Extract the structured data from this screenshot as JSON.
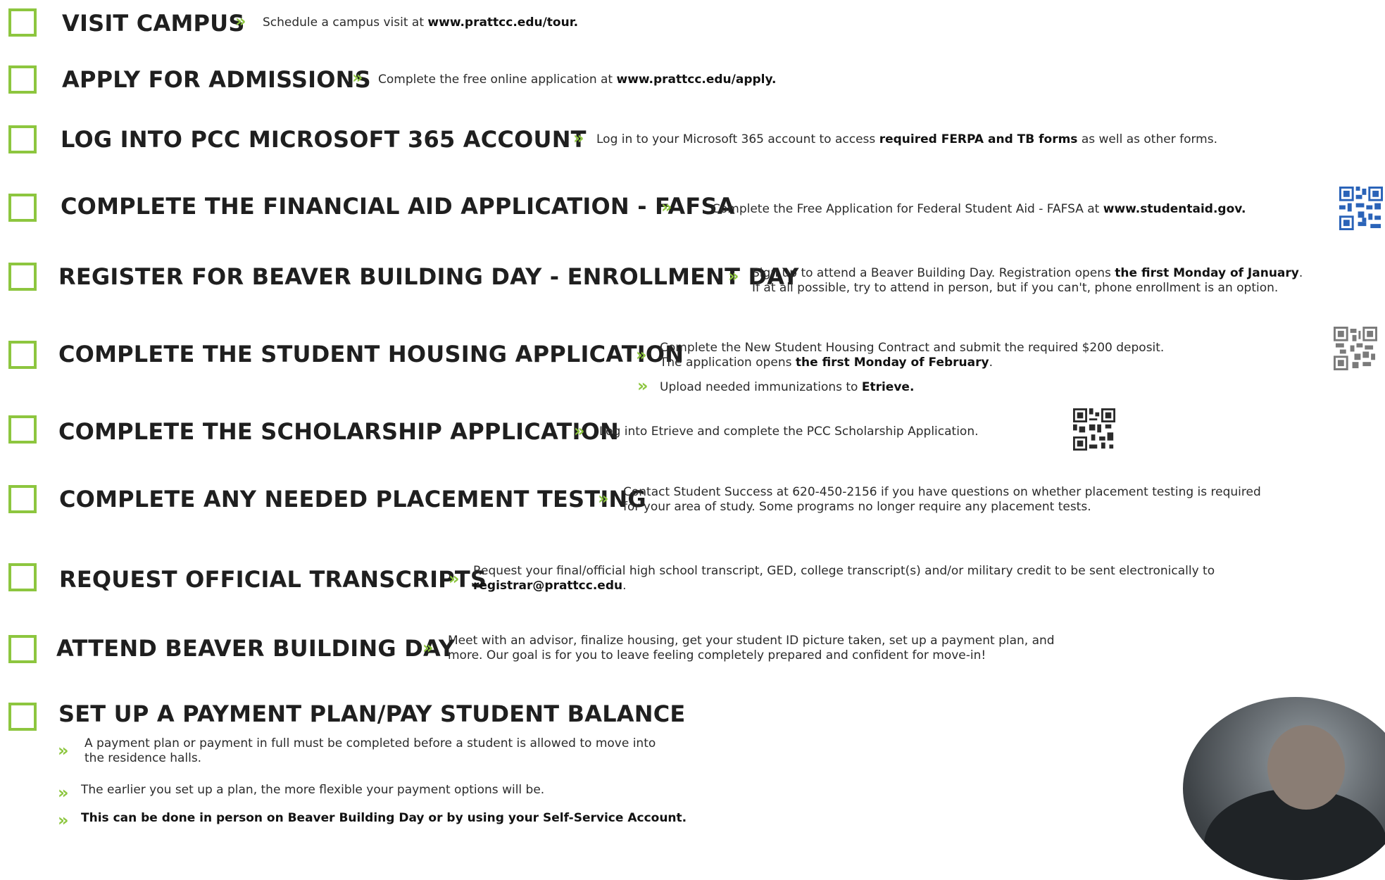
{
  "colors": {
    "accent": "#8dc63f",
    "text": "#1f1f1f"
  },
  "steps": {
    "visit": {
      "title": "VISIT CAMPUS",
      "desc_pre": "Schedule a campus visit at ",
      "desc_bold": "www.prattcc.edu/tour."
    },
    "apply": {
      "title": "APPLY FOR ADMISSIONS",
      "desc_pre": "Complete the free online application at ",
      "desc_bold": "www.prattcc.edu/apply."
    },
    "login": {
      "title": "LOG INTO PCC MICROSOFT 365 ACCOUNT",
      "desc_pre": "Log in to your Microsoft 365 account to access ",
      "desc_bold": "required FERPA and TB forms",
      "desc_post": " as well as other forms."
    },
    "fafsa": {
      "title": "COMPLETE THE FINANCIAL AID APPLICATION - FAFSA",
      "desc_pre": "Complete the Free Application for Federal Student Aid - FAFSA at ",
      "desc_bold": "www.studentaid.gov."
    },
    "register": {
      "title": "REGISTER FOR BEAVER BUILDING DAY - ENROLLMENT DAY",
      "line1_pre": "Sign up to attend a Beaver Building Day. Registration opens ",
      "line1_bold": "the first Monday of January",
      "line1_post": ".",
      "line2": "If at all possible, try to attend in person, but if you can't, phone enrollment is an option."
    },
    "housing": {
      "title": "COMPLETE THE STUDENT HOUSING APPLICATION",
      "line1": "Complete the New Student Housing Contract and submit the required $200 deposit.",
      "line2_pre": "The application opens ",
      "line2_bold": "the first Monday of February",
      "line2_post": ".",
      "bullet_pre": "Upload needed immunizations to ",
      "bullet_bold": "Etrieve."
    },
    "scholarship": {
      "title": "COMPLETE THE SCHOLARSHIP APPLICATION",
      "desc": "Log into Etrieve and complete the PCC Scholarship Application."
    },
    "placement": {
      "title": "COMPLETE ANY NEEDED PLACEMENT TESTING",
      "line1": "Contact Student Success at 620-450-2156 if you have questions on whether placement testing is required",
      "line2": "for your area of study. Some programs no longer require any placement tests."
    },
    "transcripts": {
      "title": "REQUEST OFFICIAL TRANSCRIPTS",
      "line1": "Request your final/official high school transcript, GED, college transcript(s) and/or military credit to be sent electronically to",
      "line2_bold": "registrar@prattcc.edu",
      "line2_post": "."
    },
    "attend": {
      "title": "ATTEND BEAVER BUILDING DAY",
      "line1": "Meet with an advisor, finalize housing, get your student ID picture taken, set up a payment plan, and",
      "line2": "more. Our goal is for you to leave feeling completely prepared and confident for move-in!"
    },
    "payment": {
      "title": "SET UP A PAYMENT PLAN/PAY STUDENT BALANCE",
      "b1_line1": "A payment plan or payment in full must be completed before a student is allowed to move into",
      "b1_line2": "the residence halls.",
      "b2": "The earlier you set up a plan, the more flexible your payment options will be.",
      "b3": "This can be done in person on Beaver Building Day or by using your Self-Service Account."
    }
  },
  "arrow_glyph": "»",
  "icons": {
    "checkbox": "empty-checkbox",
    "qr": "qr-code",
    "arrow": "double-chevron-right"
  }
}
